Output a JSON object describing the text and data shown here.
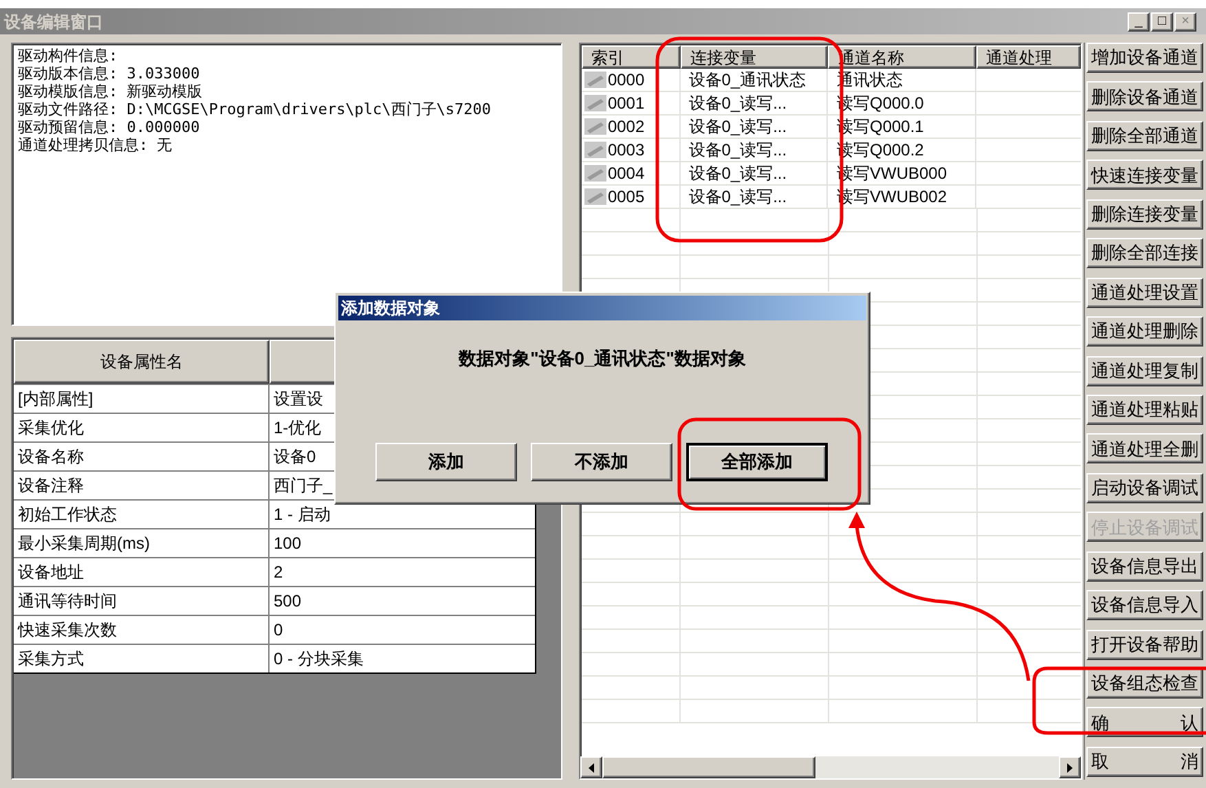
{
  "window": {
    "title": "设备编辑窗口",
    "controls": [
      "_",
      "□",
      "×"
    ]
  },
  "info_lines": [
    "驱动构件信息:",
    "驱动版本信息: 3.033000",
    "驱动模版信息: 新驱动模版",
    "驱动文件路径: D:\\MCGSE\\Program\\drivers\\plc\\西门子\\s7200",
    "驱动预留信息: 0.000000",
    "通道处理拷贝信息: 无"
  ],
  "properties": {
    "columns": [
      "设备属性名"
    ],
    "rows": [
      {
        "name": "[内部属性]",
        "value": "设置设"
      },
      {
        "name": "采集优化",
        "value": "1-优化"
      },
      {
        "name": "设备名称",
        "value": "设备0"
      },
      {
        "name": "设备注释",
        "value": "西门子_"
      },
      {
        "name": "初始工作状态",
        "value": "1 - 启动"
      },
      {
        "name": "最小采集周期(ms)",
        "value": "100"
      },
      {
        "name": "设备地址",
        "value": "2"
      },
      {
        "name": "通讯等待时间",
        "value": "500"
      },
      {
        "name": "快速采集次数",
        "value": "0"
      },
      {
        "name": "采集方式",
        "value": "0 - 分块采集"
      }
    ]
  },
  "channels": {
    "columns": [
      "索引",
      "连接变量",
      "通道名称",
      "通道处理"
    ],
    "rows": [
      {
        "index": "0000",
        "variable": "设备0_通讯状态",
        "name": "通讯状态"
      },
      {
        "index": "0001",
        "variable": "设备0_读写...",
        "name": "读写Q000.0"
      },
      {
        "index": "0002",
        "variable": "设备0_读写...",
        "name": "读写Q000.1"
      },
      {
        "index": "0003",
        "variable": "设备0_读写...",
        "name": "读写Q000.2"
      },
      {
        "index": "0004",
        "variable": "设备0_读写...",
        "name": "读写VWUB000"
      },
      {
        "index": "0005",
        "variable": "设备0_读写...",
        "name": "读写VWUB002"
      }
    ]
  },
  "buttons": [
    {
      "label": "增加设备通道",
      "disabled": false
    },
    {
      "label": "删除设备通道",
      "disabled": false
    },
    {
      "label": "删除全部通道",
      "disabled": false
    },
    {
      "label": "快速连接变量",
      "disabled": false
    },
    {
      "label": "删除连接变量",
      "disabled": false
    },
    {
      "label": "删除全部连接",
      "disabled": false
    },
    {
      "label": "通道处理设置",
      "disabled": false
    },
    {
      "label": "通道处理删除",
      "disabled": false
    },
    {
      "label": "通道处理复制",
      "disabled": false
    },
    {
      "label": "通道处理粘贴",
      "disabled": false
    },
    {
      "label": "通道处理全删",
      "disabled": false
    },
    {
      "label": "启动设备调试",
      "disabled": false
    },
    {
      "label": "停止设备调试",
      "disabled": true
    },
    {
      "label": "设备信息导出",
      "disabled": false
    },
    {
      "label": "设备信息导入",
      "disabled": false
    },
    {
      "label": "打开设备帮助",
      "disabled": false
    },
    {
      "label": "设备组态检查",
      "disabled": false
    },
    {
      "label": "确 认",
      "disabled": false
    },
    {
      "label": "取 消",
      "disabled": false
    }
  ],
  "dialog": {
    "title": "添加数据对象",
    "message": "数据对象\"设备0_通讯状态\"数据对象",
    "buttons": [
      {
        "label": "添加",
        "default": false
      },
      {
        "label": "不添加",
        "default": false
      },
      {
        "label": "全部添加",
        "default": true
      }
    ]
  }
}
